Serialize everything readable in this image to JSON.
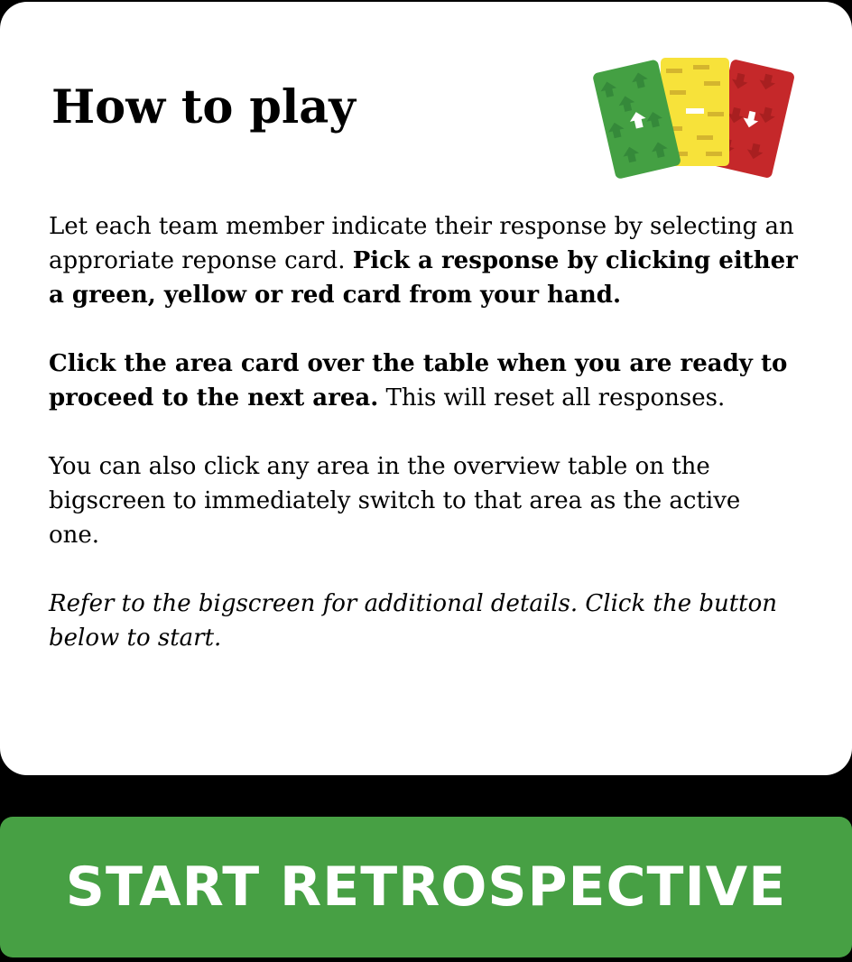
{
  "dialog": {
    "title": "How to play",
    "illustration_icon": "response-cards-icon",
    "colors": {
      "green_card": "#44a043",
      "yellow_card": "#f7e23a",
      "red_card": "#c5282a",
      "button": "#47a044"
    },
    "paragraph1": {
      "normal": "Let each team member indicate their response by selecting an approriate reponse card. ",
      "bold": "Pick a response by clicking either a green, yellow or red card from your hand."
    },
    "paragraph2": {
      "bold": "Click the area card over the table when you are ready to proceed to the next area.",
      "normal": " This will reset all responses."
    },
    "paragraph3": "You can also click any area in the overview table on the bigscreen to immediately switch to that area as the active one.",
    "paragraph4": "Refer to the bigscreen for additional details. Click the button below to start."
  },
  "start_button": {
    "label": "START RETROSPECTIVE"
  }
}
